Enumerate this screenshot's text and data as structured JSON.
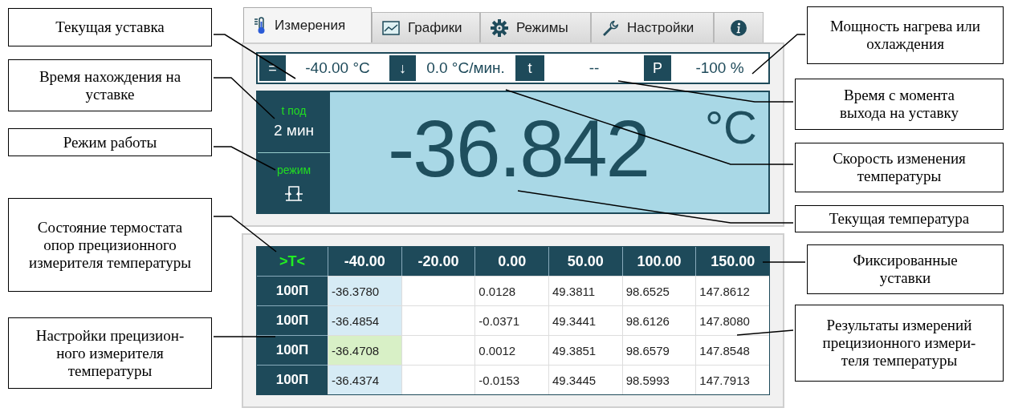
{
  "tabs": [
    {
      "label": "Измерения",
      "selected": true
    },
    {
      "label": "Графики",
      "selected": false
    },
    {
      "label": "Режимы",
      "selected": false
    },
    {
      "label": "Настройки",
      "selected": false
    },
    {
      "selected": false
    }
  ],
  "status_bar": [
    {
      "key": "=",
      "value": "-40.00 °C"
    },
    {
      "key": "↓",
      "value": "0.0 °C/мин."
    },
    {
      "key": "t",
      "value": "--"
    },
    {
      "key": "P",
      "value": "-100 %"
    }
  ],
  "display": {
    "side": [
      {
        "kind": "text",
        "caption": "t под",
        "value": "2 мин"
      },
      {
        "kind": "mode_icon",
        "caption": "режим"
      }
    ],
    "value": "-36.842",
    "unit": "°C"
  },
  "table": {
    "corner": ">T<",
    "columns": [
      {
        "label": "-40.00",
        "selected": true
      },
      {
        "label": "-20.00",
        "selected": false
      },
      {
        "label": "0.00",
        "selected": false
      },
      {
        "label": "50.00",
        "selected": false
      },
      {
        "label": "100.00",
        "selected": false
      },
      {
        "label": "150.00",
        "selected": false
      }
    ],
    "rows": [
      {
        "label": "100П",
        "current": false,
        "cells": [
          {
            "text": "-36.3780"
          },
          {
            "empty": true
          },
          {
            "text": "0.0128"
          },
          {
            "text": "49.3811"
          },
          {
            "text": "98.6525"
          },
          {
            "text": "147.8612"
          }
        ]
      },
      {
        "label": "100П",
        "current": false,
        "cells": [
          {
            "text": "-36.4854"
          },
          {
            "empty": true
          },
          {
            "text": "-0.0371"
          },
          {
            "text": "49.3441"
          },
          {
            "text": "98.6126"
          },
          {
            "text": "147.8080"
          }
        ]
      },
      {
        "label": "100П",
        "current": true,
        "cells": [
          {
            "text": "-36.4708"
          },
          {
            "empty": true
          },
          {
            "text": "0.0012"
          },
          {
            "text": "49.3851"
          },
          {
            "text": "98.6579"
          },
          {
            "text": "147.8548"
          }
        ]
      },
      {
        "label": "100П",
        "current": false,
        "cells": [
          {
            "text": "-36.4374"
          },
          {
            "empty": true
          },
          {
            "text": "-0.0153"
          },
          {
            "text": "49.3445"
          },
          {
            "text": "98.5993"
          },
          {
            "text": "147.7913"
          }
        ]
      }
    ]
  },
  "callouts_left": [
    {
      "text": "Текущая уставка"
    },
    {
      "text": "Время нахождения на уставке"
    },
    {
      "text": "Режим работы"
    },
    {
      "text": "Состояние термостата опор прецизионного измерителя температуры"
    },
    {
      "text": "Настройки прецизион-ного измерителя температуры"
    }
  ],
  "callouts_right": [
    {
      "text": "Мощность нагрева или охлаждения"
    },
    {
      "text": "Время с момента выхода на уставку"
    },
    {
      "text": "Скорость изменения температуры"
    },
    {
      "text": "Текущая температура"
    },
    {
      "text": "Фиксированные уставки"
    },
    {
      "text": "Результаты измерений прецизионного измери-теля температуры"
    }
  ]
}
